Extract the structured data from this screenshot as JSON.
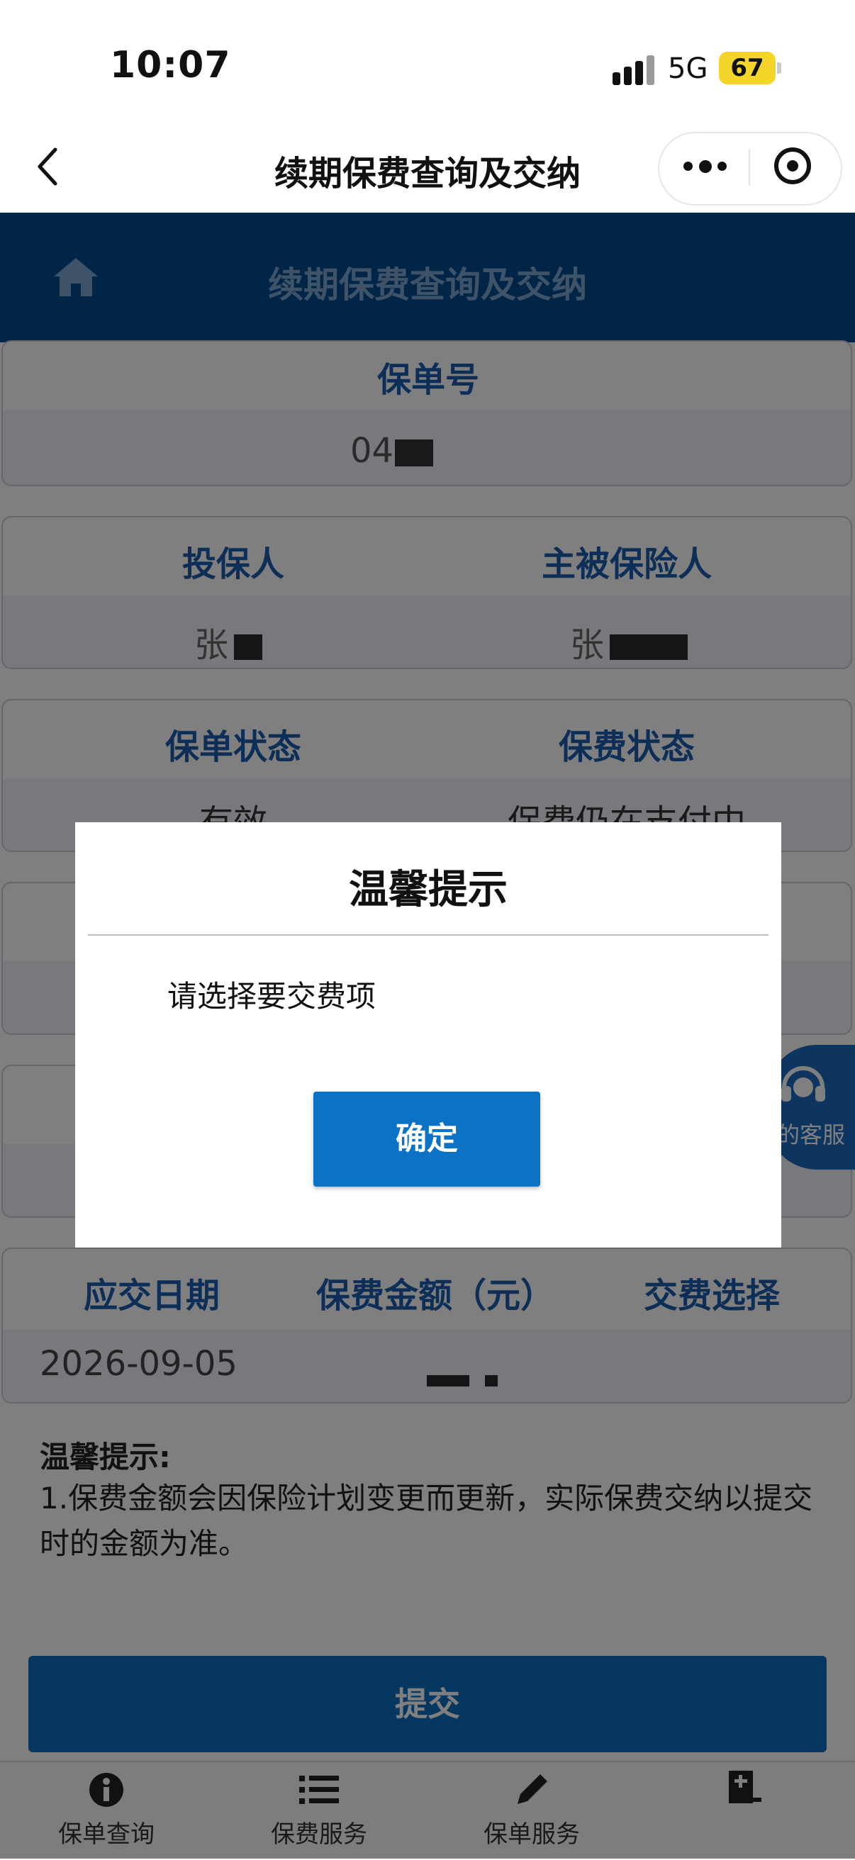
{
  "status_bar": {
    "time": "10:07",
    "network": "5G",
    "battery": "67"
  },
  "nav": {
    "title": "续期保费查询及交纳",
    "back_glyph": "‹"
  },
  "header": {
    "title": "续期保费查询及交纳"
  },
  "policy": {
    "label": "保单号",
    "value_visible": "04"
  },
  "people": {
    "holder_label": "投保人",
    "holder_value_visible": "张",
    "insured_label": "主被保险人",
    "insured_value_visible": "张"
  },
  "status": {
    "policy_status_label": "保单状态",
    "policy_status_value": "有效",
    "premium_status_label": "保费状态",
    "premium_status_value": "保费仍在支付中"
  },
  "payment_table": {
    "headers": [
      "应交日期",
      "保费金额（元）",
      "交费选择"
    ],
    "rows": [
      {
        "due_date": "2026-09-05"
      }
    ]
  },
  "notes": {
    "title": "温馨提示:",
    "body": "1.保费金额会因保险计划变更而更新，实际保费交纳以提交时的金额为准。"
  },
  "submit_label": "提交",
  "service_label": "的客服",
  "tabbar": {
    "items": [
      {
        "label": "保单查询",
        "icon": "info-icon"
      },
      {
        "label": "保费服务",
        "icon": "list-icon"
      },
      {
        "label": "保单服务",
        "icon": "pen-icon"
      },
      {
        "label": "",
        "icon": "document-icon"
      }
    ]
  },
  "modal": {
    "title": "温馨提示",
    "message": "请选择要交费项",
    "confirm_label": "确定"
  },
  "colors": {
    "brand_blue": "#004b8e",
    "button_blue": "#0c72c5",
    "label_blue": "#1b5fae",
    "battery": "#f5d52a"
  }
}
